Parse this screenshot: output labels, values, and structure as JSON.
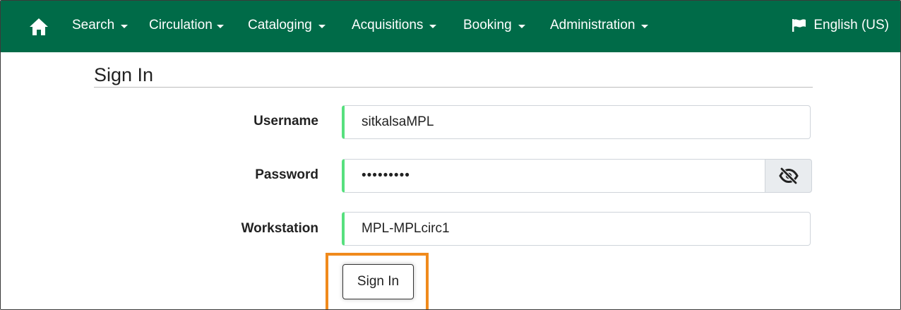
{
  "navbar": {
    "home_icon": "home-icon",
    "items": [
      {
        "label": "Search"
      },
      {
        "label": "Circulation"
      },
      {
        "label": "Cataloging"
      },
      {
        "label": "Acquisitions"
      },
      {
        "label": "Booking"
      },
      {
        "label": "Administration"
      }
    ],
    "language": {
      "label": "English (US)",
      "icon": "flag-icon"
    },
    "background_color": "#006b48"
  },
  "signin_form": {
    "title": "Sign In",
    "username": {
      "label": "Username",
      "value": "sitkalsaMPL"
    },
    "password": {
      "label": "Password",
      "value": "•••••••••",
      "toggle_icon": "eye-slash-icon"
    },
    "workstation": {
      "label": "Workstation",
      "value": "MPL-MPLcirc1"
    },
    "submit_label": "Sign In",
    "highlight_color": "#f08a1c",
    "field_accent_color": "#57e07e"
  }
}
